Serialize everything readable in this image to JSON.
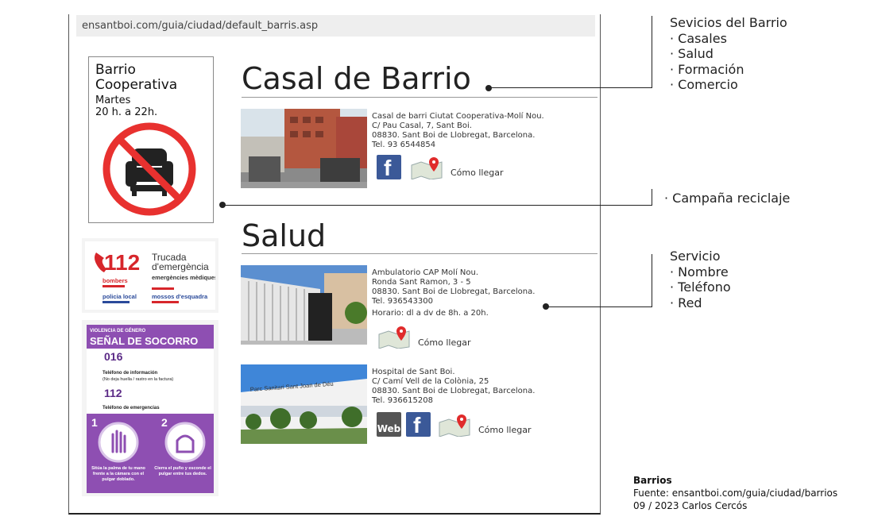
{
  "browser": {
    "url": "ensantboi.com/guia/ciudad/default_barris.asp"
  },
  "barrio_box": {
    "title_line1": "Barrio",
    "title_line2": "Cooperativa",
    "day": "Martes",
    "hours": "20 h. a 22h."
  },
  "card_112": {
    "number": "112",
    "text_line1": "Trucada",
    "text_line2": "d'emergència",
    "services": [
      "bombers",
      "emergències mèdiques",
      "policia local",
      "mossos d'esquadra"
    ]
  },
  "socorro": {
    "tag": "VIOLENCIA DE GÉNERO",
    "title": "SEÑAL DE SOCORRO",
    "phone1": "016",
    "phone1_desc": "Teléfono de información",
    "phone1_note": "(No deja huella / rastro en la factura)",
    "phone2": "112",
    "phone2_desc": "Teléfono de emergencias",
    "step1_num": "1",
    "step2_num": "2",
    "step1_text": "Sitúa la palma de tu mano frente a la cámara con el pulgar doblado.",
    "step2_text": "Cierra el puño y esconde el pulgar entre tus dedos."
  },
  "sections": {
    "casal": {
      "heading": "Casal de Barrio",
      "listing": {
        "lines": [
          "Casal de barri Ciutat Cooperativa-Molí Nou.",
          "C/ Pau Casal, 7, Sant Boi.",
          "08830. Sant Boi de Llobregat, Barcelona.",
          "Tel. 93 6544854"
        ],
        "directions": "Cómo llegar"
      }
    },
    "salud": {
      "heading": "Salud",
      "listing1": {
        "lines": [
          "Ambulatorio CAP Molí Nou.",
          "Ronda Sant Ramon, 3 - 5",
          "08830. Sant Boi de Llobregat, Barcelona.",
          "Tel. 936543300"
        ],
        "hours": "Horario: dl a dv de 8h. a 20h.",
        "directions": "Cómo llegar"
      },
      "listing2": {
        "lines": [
          "Hospital de Sant Boi.",
          "C/ Camí Vell de la Colònia, 25",
          "08830. Sant Boi de Llobregat, Barcelona.",
          "Tel. 936615208"
        ],
        "photo_sign": "Parc Sanitari Sant Joan de Déu",
        "web_label": "Web",
        "directions": "Cómo llegar"
      }
    }
  },
  "annotations": {
    "servicios": [
      "Sevicios del Barrio",
      "· Casales",
      "· Salud",
      "· Formación",
      "· Comercio"
    ],
    "campana": "· Campaña reciclaje",
    "servicio": [
      "Servicio",
      "· Nombre",
      "· Teléfono",
      "· Red"
    ]
  },
  "credit": {
    "title": "Barrios",
    "source": "Fuente: ensantboi.com/guia/ciudad/barrios",
    "date_author": "09 / 2023  Carlos Cercós"
  },
  "colors": {
    "facebook": "#3b5998",
    "socorro_purple": "#8e4fb2",
    "emergency_red": "#d7262b",
    "no_sign_red": "#e8312f"
  }
}
